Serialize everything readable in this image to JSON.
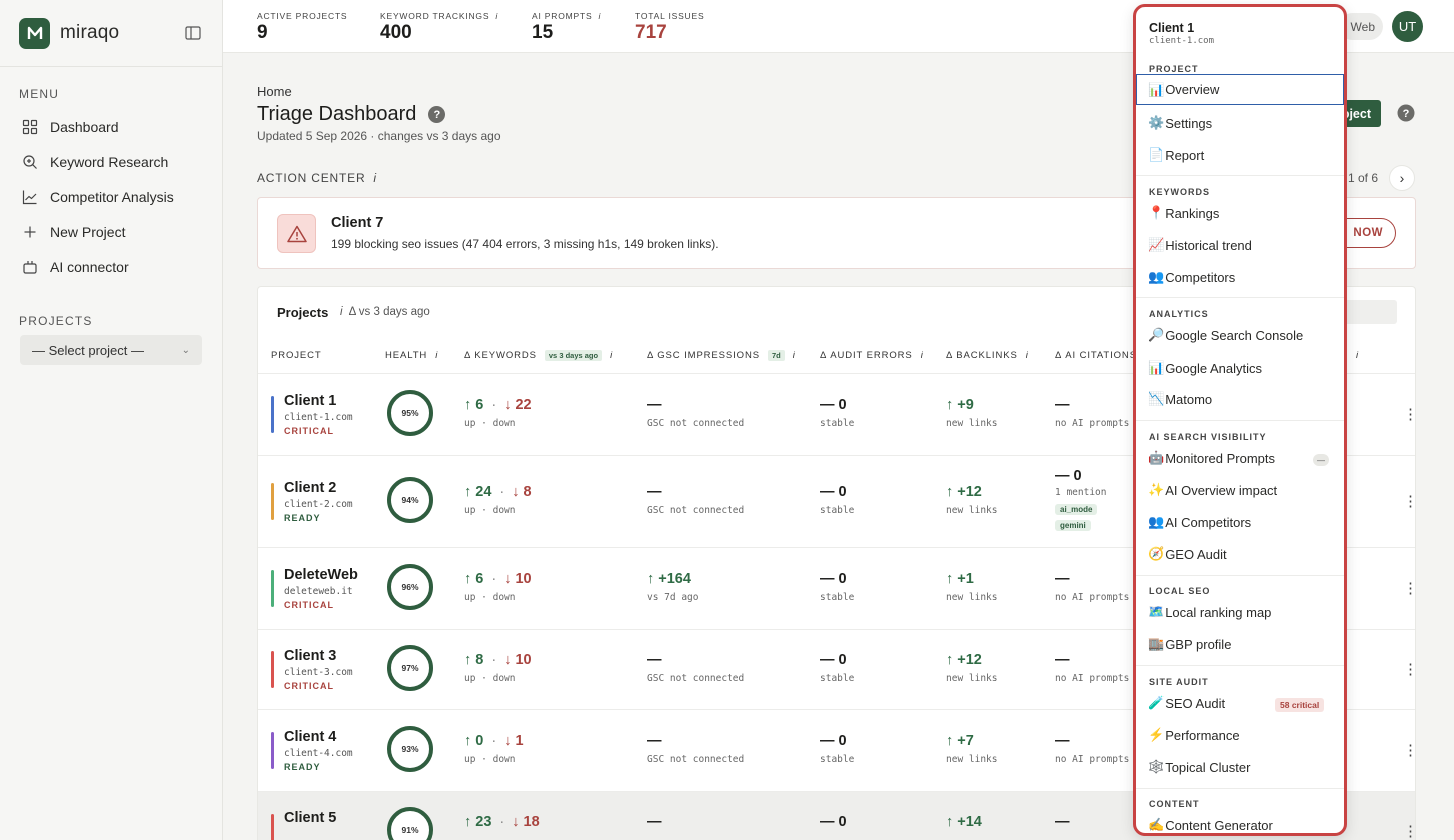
{
  "brand": {
    "name": "miraqo"
  },
  "sidebar": {
    "menu_title": "MENU",
    "items": [
      {
        "label": "Dashboard",
        "icon": "grid-icon"
      },
      {
        "label": "Keyword Research",
        "icon": "search-plus-icon"
      },
      {
        "label": "Competitor Analysis",
        "icon": "chart-line-icon"
      },
      {
        "label": "New Project",
        "icon": "plus-icon"
      },
      {
        "label": "AI connector",
        "icon": "plug-icon"
      }
    ],
    "projects_title": "PROJECTS",
    "select_value": "— Select project —"
  },
  "metrics": [
    {
      "label": "ACTIVE PROJECTS",
      "value": "9",
      "info": ""
    },
    {
      "label": "KEYWORD TRACKINGS",
      "value": "400",
      "info": "i"
    },
    {
      "label": "AI PROMPTS",
      "value": "15",
      "info": "i"
    },
    {
      "label": "TOTAL ISSUES",
      "value": "717",
      "info": "",
      "color": "#a8433e"
    }
  ],
  "topbar": {
    "web_label": "Web",
    "avatar": "UT"
  },
  "page": {
    "breadcrumb": "Home",
    "title": "Triage Dashboard",
    "help": "?",
    "updated": "Updated 5 Sep 2026 · changes vs 3 days ago",
    "new_project_btn": "oject",
    "action_center": "ACTION CENTER",
    "info": "i",
    "pager": "1 of 6",
    "pager_next": "›"
  },
  "alert": {
    "title": "Client 7",
    "description": "199 blocking seo issues (47 404 errors, 3 missing h1s, 149 broken links).",
    "button": "NOW"
  },
  "table": {
    "title": "Projects",
    "subtitle": "Δ vs 3 days ago",
    "info": "i",
    "headers": {
      "project": "PROJECT",
      "health": "HEALTH",
      "keywords": "Δ KEYWORDS",
      "keywords_tag": "vs 3 days ago",
      "gsc": "Δ GSC IMPRESSIONS",
      "gsc_tag": "7d",
      "audit": "Δ AUDIT ERRORS",
      "backlinks": "Δ BACKLINKS",
      "ai": "Δ AI CITATIONS",
      "gsc_short": "SC"
    },
    "rows": [
      {
        "name": "Client 1",
        "domain": "client-1.com",
        "status": "CRITICAL",
        "bar": "#4a72c9",
        "health": "95%",
        "kw_up": "↑ 6",
        "kw_down": "↓ 22",
        "kw_sub": "up · down",
        "gsc": "—",
        "gsc_sub": "GSC not connected",
        "audit": "— 0",
        "audit_sub": "stable",
        "bl": "↑ +9",
        "bl_sub": "new links",
        "ai": "—",
        "ai_sub": "no AI prompts"
      },
      {
        "name": "Client 2",
        "domain": "client-2.com",
        "status": "READY",
        "bar": "#e0a040",
        "health": "94%",
        "kw_up": "↑ 24",
        "kw_down": "↓ 8",
        "kw_sub": "up · down",
        "gsc": "—",
        "gsc_sub": "GSC not connected",
        "audit": "— 0",
        "audit_sub": "stable",
        "bl": "↑ +12",
        "bl_sub": "new links",
        "ai": "— 0",
        "ai_sub": "1 mention",
        "pills": [
          "ai_mode",
          "gemini"
        ]
      },
      {
        "name": "DeleteWeb",
        "domain": "deleteweb.it",
        "status": "CRITICAL",
        "bar": "#4caf7a",
        "health": "96%",
        "kw_up": "↑ 6",
        "kw_down": "↓ 10",
        "kw_sub": "up · down",
        "gsc": "↑ +164",
        "gsc_sub": "vs 7d ago",
        "audit": "— 0",
        "audit_sub": "stable",
        "bl": "↑ +1",
        "bl_sub": "new links",
        "ai": "—",
        "ai_sub": "no AI prompts"
      },
      {
        "name": "Client 3",
        "domain": "client-3.com",
        "status": "CRITICAL",
        "bar": "#d9534f",
        "health": "97%",
        "kw_up": "↑ 8",
        "kw_down": "↓ 10",
        "kw_sub": "up · down",
        "gsc": "—",
        "gsc_sub": "GSC not connected",
        "audit": "— 0",
        "audit_sub": "stable",
        "bl": "↑ +12",
        "bl_sub": "new links",
        "ai": "—",
        "ai_sub": "no AI prompts"
      },
      {
        "name": "Client 4",
        "domain": "client-4.com",
        "status": "READY",
        "bar": "#8a5cc9",
        "health": "93%",
        "kw_up": "↑ 0",
        "kw_down": "↓ 1",
        "kw_sub": "up · down",
        "gsc": "—",
        "gsc_sub": "GSC not connected",
        "audit": "— 0",
        "audit_sub": "stable",
        "bl": "↑ +7",
        "bl_sub": "new links",
        "ai": "—",
        "ai_sub": "no AI prompts"
      },
      {
        "name": "Client 5",
        "domain": "client-5.com",
        "status": "",
        "bar": "#d9534f",
        "health": "91%",
        "kw_up": "↑ 23",
        "kw_down": "↓ 18",
        "kw_sub": "",
        "gsc": "—",
        "gsc_sub": "",
        "audit": "— 0",
        "audit_sub": "",
        "bl": "↑ +14",
        "bl_sub": "",
        "ai": "—",
        "ai_sub": ""
      }
    ]
  },
  "dropdown": {
    "client": "Client 1",
    "domain": "client-1.com",
    "sections": [
      {
        "title": "PROJECT",
        "items": [
          {
            "emoji": "📊",
            "label": "Overview",
            "active": true
          },
          {
            "emoji": "⚙️",
            "label": "Settings"
          },
          {
            "emoji": "📄",
            "label": "Report"
          }
        ]
      },
      {
        "title": "KEYWORDS",
        "items": [
          {
            "emoji": "📍",
            "label": "Rankings"
          },
          {
            "emoji": "📈",
            "label": "Historical trend"
          },
          {
            "emoji": "👥",
            "label": "Competitors"
          }
        ]
      },
      {
        "title": "ANALYTICS",
        "items": [
          {
            "emoji": "🔎",
            "label": "Google Search Console"
          },
          {
            "emoji": "📊",
            "label": "Google Analytics"
          },
          {
            "emoji": "📉",
            "label": "Matomo"
          }
        ]
      },
      {
        "title": "AI SEARCH VISIBILITY",
        "items": [
          {
            "emoji": "🤖",
            "label": "Monitored Prompts",
            "dash": "—"
          },
          {
            "emoji": "✨",
            "label": "AI Overview impact"
          },
          {
            "emoji": "👥",
            "label": "AI Competitors"
          },
          {
            "emoji": "🧭",
            "label": "GEO Audit"
          }
        ]
      },
      {
        "title": "LOCAL SEO",
        "items": [
          {
            "emoji": "🗺️",
            "label": "Local ranking map"
          },
          {
            "emoji": "🏬",
            "label": "GBP profile"
          }
        ]
      },
      {
        "title": "SITE AUDIT",
        "items": [
          {
            "emoji": "🧪",
            "label": "SEO Audit",
            "badge": "58 critical"
          },
          {
            "emoji": "⚡",
            "label": "Performance"
          },
          {
            "emoji": "🕸️",
            "label": "Topical Cluster"
          }
        ]
      },
      {
        "title": "CONTENT",
        "items": [
          {
            "emoji": "✍️",
            "label": "Content Generator"
          }
        ]
      }
    ]
  }
}
